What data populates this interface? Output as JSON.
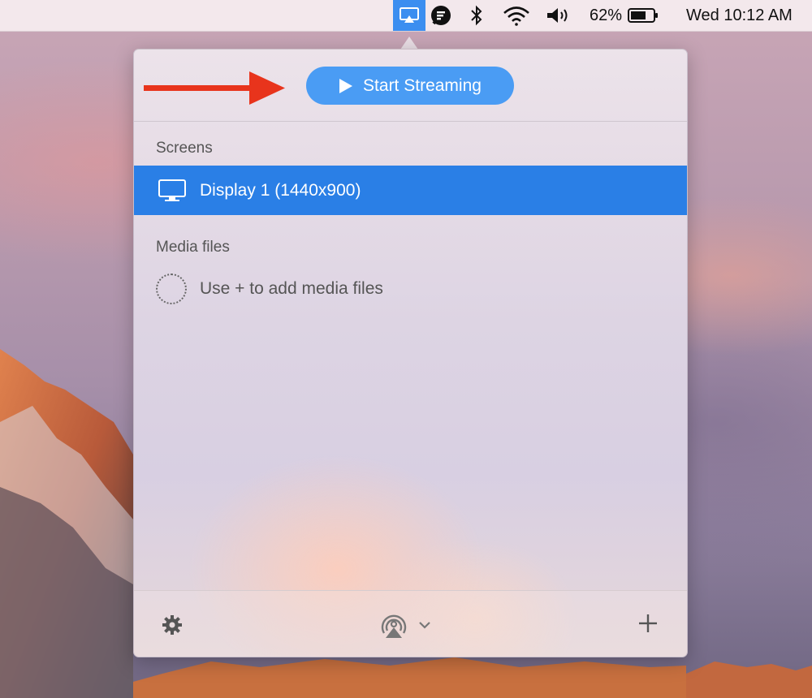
{
  "menubar": {
    "battery_percent": "62%",
    "clock": "Wed 10:12 AM",
    "icons": [
      "airplay-icon",
      "chat-app-icon",
      "bluetooth-icon",
      "wifi-icon",
      "volume-icon",
      "battery-icon"
    ]
  },
  "popover": {
    "start_button_label": "Start Streaming",
    "screens_title": "Screens",
    "screens": [
      {
        "label": "Display 1 (1440x900)",
        "selected": true
      }
    ],
    "media_title": "Media files",
    "media_empty_text": "Use + to add media files",
    "footer_icons": [
      "gear-icon",
      "airplay-cast-icon",
      "chevron-down-icon",
      "plus-icon"
    ]
  },
  "colors": {
    "accent": "#4a9cf4",
    "selection": "#2a7fe6",
    "menubar_highlight": "#3b8ef0",
    "annotation_arrow": "#e8341c"
  }
}
